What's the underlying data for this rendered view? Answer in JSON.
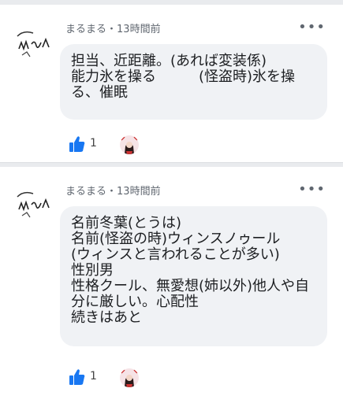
{
  "comments": [
    {
      "author": "まるまる",
      "time": "13時間前",
      "separator": "・",
      "text": "担当、近距離。(あれば変装係)\n能力氷を操る　　　(怪盗時)氷を操る、催眠",
      "likes": "1"
    },
    {
      "author": "まるまる",
      "time": "13時間前",
      "separator": "・",
      "text": "名前冬葉(とうは)\n名前(怪盗の時)ウィンスノゥール\n(ウィンスと言われることが多い)\n性別男\n性格クール、無愛想(姉以外)他人や自分に厳しい。心配性\n続きはあと",
      "likes": "1"
    }
  ],
  "more_glyph": "•••",
  "colors": {
    "like_blue": "#1877f2",
    "bubble_bg": "#f0f2f5",
    "meta_text": "#606770"
  }
}
